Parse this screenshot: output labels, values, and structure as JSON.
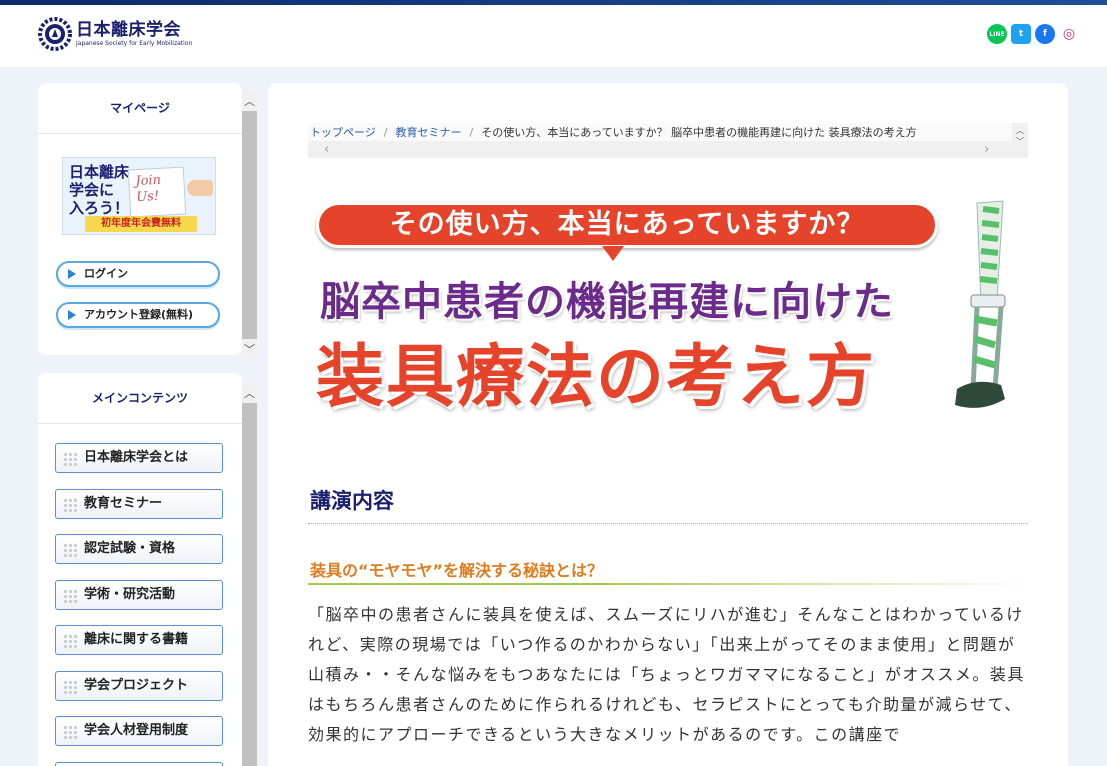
{
  "header": {
    "logo_title": "日本離床学会",
    "logo_sub": "Japanese Society for Early Mobilization",
    "social": [
      {
        "icon": "line-icon",
        "label": "LINE",
        "color": "#06c755"
      },
      {
        "icon": "twitter-icon",
        "label": "t",
        "color": "#1da1f2"
      },
      {
        "icon": "facebook-icon",
        "label": "f",
        "color": "#1877f2"
      },
      {
        "icon": "instagram-icon",
        "label": "◎",
        "color": "#c13584"
      }
    ]
  },
  "sidebar": {
    "mypage": {
      "title": "マイページ",
      "join_banner": {
        "text_line1": "日本離床",
        "text_line2": "学会に",
        "text_line3": "入ろう！",
        "paper": "Join Us!",
        "tag": "初年度年会費無料"
      },
      "login_label": "ログイン",
      "register_label": "アカウント登録(無料)"
    },
    "main_contents": {
      "title": "メインコンテンツ",
      "items": [
        "日本離床学会とは",
        "教育セミナー",
        "認定試験・資格",
        "学術・研究活動",
        "離床に関する書籍",
        "学会プロジェクト",
        "学会人材登用制度"
      ]
    }
  },
  "breadcrumb": {
    "home": "トップページ",
    "section": "教育セミナー",
    "current": "その使い方、本当にあっていますか？ 脳卒中患者の機能再建に向けた 装具療法の考え方"
  },
  "banner": {
    "bubble": "その使い方、本当にあっていますか？",
    "middle": "脳卒中患者の機能再建に向けた",
    "big": "装具療法の考え方"
  },
  "content": {
    "heading": "講演内容",
    "subheading": "装具の“モヤモヤ”を解決する秘訣とは？",
    "paragraph": "「脳卒中の患者さんに装具を使えば、スムーズにリハが進む」そんなことはわかっているけれど、実際の現場では「いつ作るのかわからない」「出来上がってそのまま使用」と問題が山積み・・そんな悩みをもつあなたには「ちょっとワガママになること」がオススメ。装具はもちろん患者さんのために作られるけれども、セラピストにとっても介助量が減らせて、効果的にアプローチできるという大きなメリットがあるのです。この講座で"
  }
}
